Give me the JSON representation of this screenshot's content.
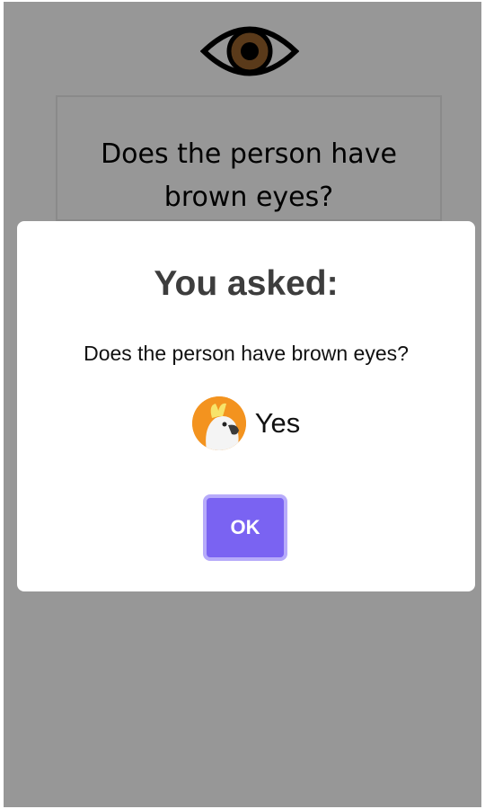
{
  "question_card": {
    "text": "Does the person have brown eyes?",
    "icon": "eye-icon"
  },
  "modal": {
    "title": "You asked:",
    "question": "Does the person have brown eyes?",
    "answer": {
      "avatar_icon": "cockatoo-avatar-icon",
      "text": "Yes"
    },
    "ok_label": "OK"
  },
  "colors": {
    "overlay": "#979797",
    "modal_background": "#ffffff",
    "button": "#7a63f2",
    "button_border": "#b7abfa",
    "avatar_background": "#f3931f",
    "iris": "#5a3a1a"
  }
}
